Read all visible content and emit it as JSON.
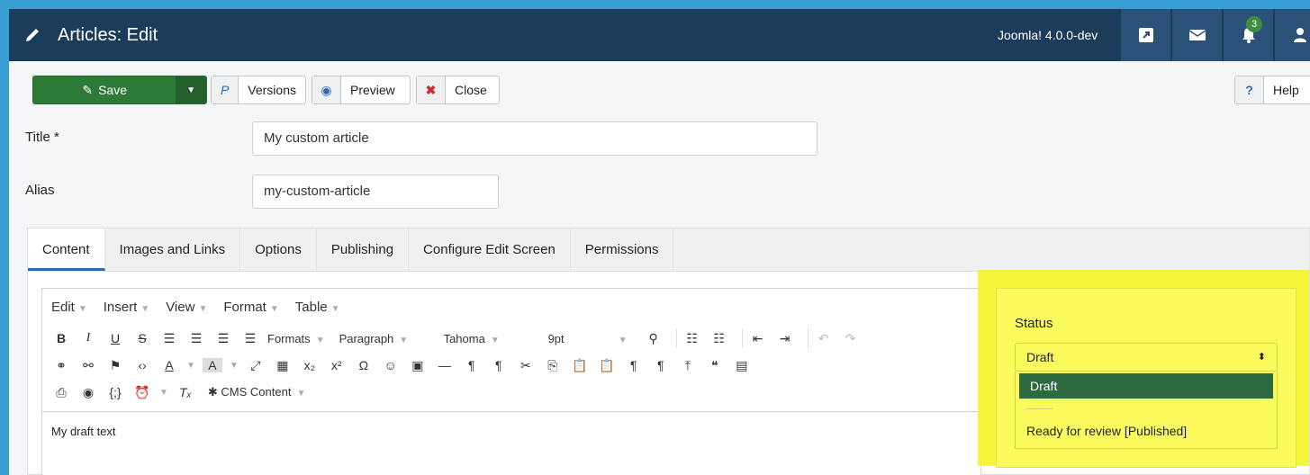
{
  "header": {
    "title": "Articles: Edit",
    "version": "Joomla! 4.0.0-dev",
    "notifications_count": "3"
  },
  "toolbar": {
    "save_label": "Save",
    "versions_label": "Versions",
    "preview_label": "Preview",
    "close_label": "Close",
    "help_label": "Help"
  },
  "form": {
    "title_label": "Title *",
    "title_value": "My custom article",
    "alias_label": "Alias",
    "alias_value": "my-custom-article"
  },
  "tabs": [
    "Content",
    "Images and Links",
    "Options",
    "Publishing",
    "Configure Edit Screen",
    "Permissions"
  ],
  "editor": {
    "menus": [
      "Edit",
      "Insert",
      "View",
      "Format",
      "Table"
    ],
    "formats_label": "Formats",
    "block_label": "Paragraph",
    "font_label": "Tahoma",
    "size_label": "9pt",
    "cms_content_label": "CMS Content",
    "content_text": "My draft text"
  },
  "status": {
    "label": "Status",
    "selected": "Draft",
    "options": [
      "Draft",
      "----------",
      "Ready for review [Published]"
    ]
  },
  "colors": {
    "header_bg": "#1c3d5a",
    "save_green": "#2d7a37",
    "highlight_yellow": "#f5f63a",
    "selected_option": "#2d6a3f",
    "tab_accent": "#2a69b8"
  }
}
